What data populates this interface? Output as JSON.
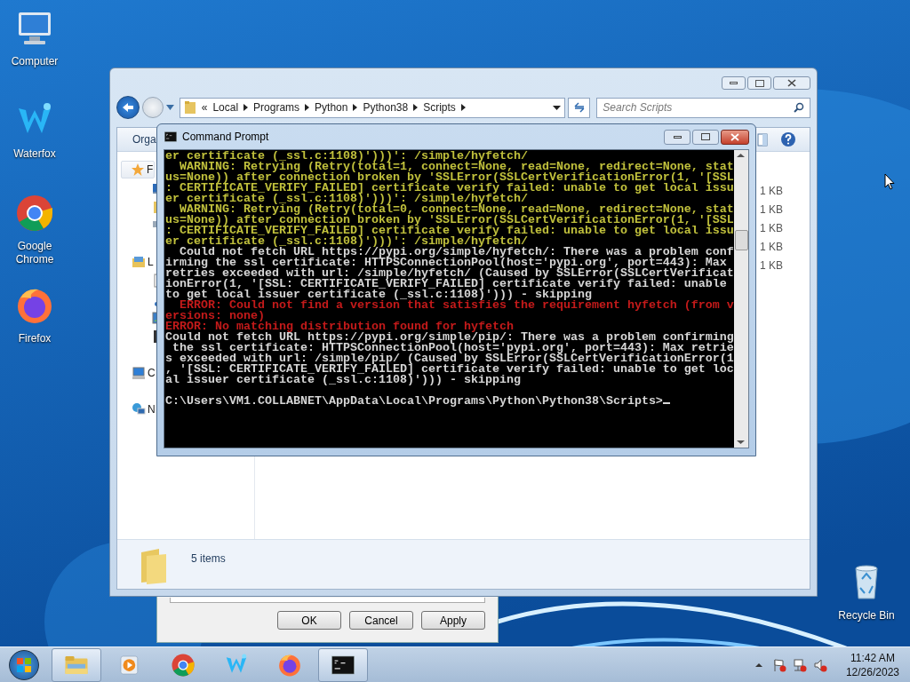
{
  "desktop_icons": [
    {
      "label": "Computer",
      "kind": "computer"
    },
    {
      "label": "Waterfox",
      "kind": "waterfox"
    },
    {
      "label": "Google Chrome",
      "kind": "chrome"
    },
    {
      "label": "Firefox",
      "kind": "firefox"
    }
  ],
  "recycle_bin": {
    "label": "Recycle Bin"
  },
  "dialog": {
    "buttons": [
      "OK",
      "Cancel",
      "Apply"
    ]
  },
  "explorer": {
    "overflow_mark": "«",
    "breadcrumb": [
      "Local",
      "Programs",
      "Python",
      "Python38",
      "Scripts"
    ],
    "search": {
      "placeholder": "Search Scripts"
    },
    "toolbar_label": "Orga",
    "nav": [
      {
        "label": "F",
        "kind": "favorites",
        "children": [
          {
            "kind": "desktop"
          },
          {
            "kind": "downloads"
          },
          {
            "kind": "recent"
          }
        ]
      },
      {
        "label": "L",
        "kind": "libraries",
        "children": [
          {
            "kind": "documents"
          },
          {
            "kind": "music"
          },
          {
            "kind": "pictures"
          },
          {
            "kind": "videos"
          }
        ]
      },
      {
        "label": "C",
        "kind": "computer"
      },
      {
        "label": "N",
        "kind": "network"
      }
    ],
    "sizes": [
      "1 KB",
      "1 KB",
      "1 KB",
      "1 KB",
      "1 KB"
    ],
    "status": "5 items"
  },
  "console": {
    "title": "Command Prompt",
    "lines": [
      {
        "kind": "warning",
        "text": "er certificate (_ssl.c:1108)')))': /simple/hyfetch/"
      },
      {
        "kind": "warning",
        "text": "  WARNING: Retrying (Retry(total=1, connect=None, read=None, redirect=None, stat"
      },
      {
        "kind": "warning",
        "text": "us=None)) after connection broken by 'SSLError(SSLCertVerificationError(1, '[SSL"
      },
      {
        "kind": "warning",
        "text": ": CERTIFICATE_VERIFY_FAILED] certificate verify failed: unable to get local issu"
      },
      {
        "kind": "warning",
        "text": "er certificate (_ssl.c:1108)')))': /simple/hyfetch/"
      },
      {
        "kind": "warning",
        "text": "  WARNING: Retrying (Retry(total=0, connect=None, read=None, redirect=None, stat"
      },
      {
        "kind": "warning",
        "text": "us=None)) after connection broken by 'SSLError(SSLCertVerificationError(1, '[SSL"
      },
      {
        "kind": "warning",
        "text": ": CERTIFICATE_VERIFY_FAILED] certificate verify failed: unable to get local issu"
      },
      {
        "kind": "warning",
        "text": "er certificate (_ssl.c:1108)')))': /simple/hyfetch/"
      },
      {
        "kind": "normal",
        "text": "  Could not fetch URL https://pypi.org/simple/hyfetch/: There was a problem conf"
      },
      {
        "kind": "normal",
        "text": "irming the ssl certificate: HTTPSConnectionPool(host='pypi.org', port=443): Max"
      },
      {
        "kind": "normal",
        "text": "retries exceeded with url: /simple/hyfetch/ (Caused by SSLError(SSLCertVerificat"
      },
      {
        "kind": "normal",
        "text": "ionError(1, '[SSL: CERTIFICATE_VERIFY_FAILED] certificate verify failed: unable"
      },
      {
        "kind": "normal",
        "text": "to get local issuer certificate (_ssl.c:1108)'))) - skipping"
      },
      {
        "kind": "error",
        "text": "  ERROR: Could not find a version that satisfies the requirement hyfetch (from v"
      },
      {
        "kind": "error",
        "text": "ersions: none)"
      },
      {
        "kind": "error",
        "text": "ERROR: No matching distribution found for hyfetch"
      },
      {
        "kind": "normal",
        "text": "Could not fetch URL https://pypi.org/simple/pip/: There was a problem confirming"
      },
      {
        "kind": "normal",
        "text": " the ssl certificate: HTTPSConnectionPool(host='pypi.org', port=443): Max retrie"
      },
      {
        "kind": "normal",
        "text": "s exceeded with url: /simple/pip/ (Caused by SSLError(SSLCertVerificationError(1"
      },
      {
        "kind": "normal",
        "text": ", '[SSL: CERTIFICATE_VERIFY_FAILED] certificate verify failed: unable to get loc"
      },
      {
        "kind": "normal",
        "text": "al issuer certificate (_ssl.c:1108)'))) - skipping"
      },
      {
        "kind": "prompt",
        "text": "C:\\Users\\VM1.COLLABNET\\AppData\\Local\\Programs\\Python\\Python38\\Scripts>"
      }
    ]
  },
  "taskbar": {
    "items": [
      {
        "kind": "explorer",
        "running": true
      },
      {
        "kind": "media",
        "running": false
      },
      {
        "kind": "chrome",
        "running": false
      },
      {
        "kind": "waterfox",
        "running": false
      },
      {
        "kind": "firefox",
        "running": false
      },
      {
        "kind": "console",
        "running": true
      }
    ],
    "clock": {
      "time": "11:42 AM",
      "date": "12/26/2023"
    }
  }
}
